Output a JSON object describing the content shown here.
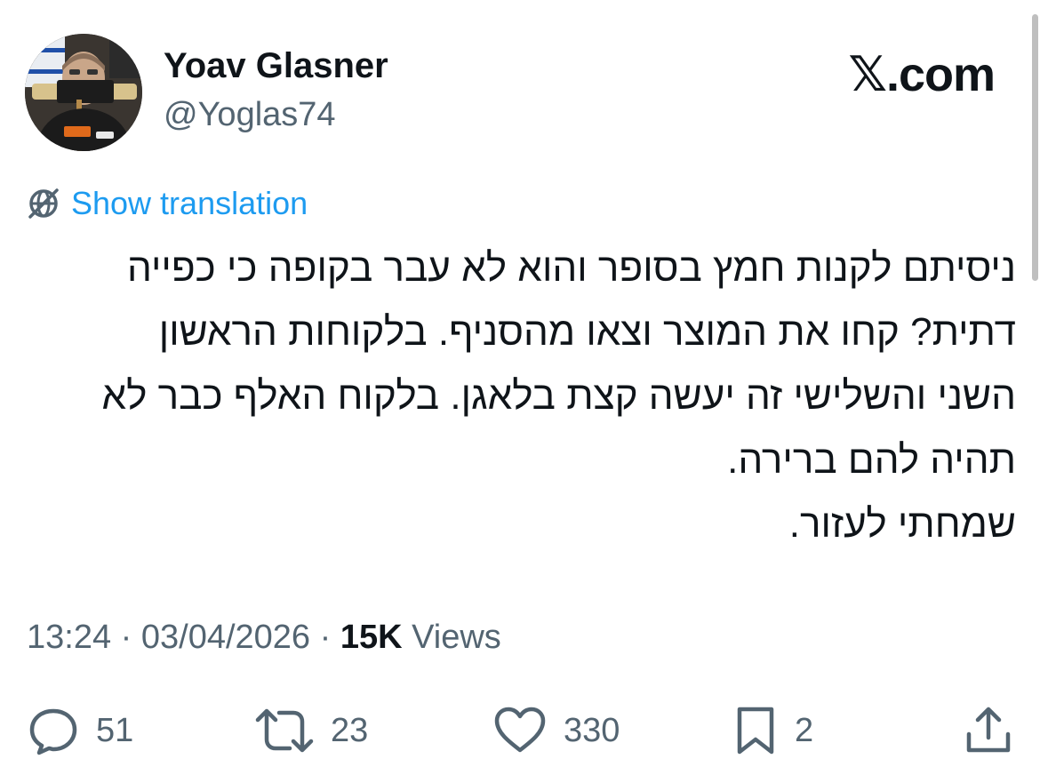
{
  "author": {
    "display_name": "Yoav Glasner",
    "handle": "@Yoglas74",
    "avatar_icon": "profile-photo"
  },
  "brand": "𝕏.com",
  "translation": {
    "icon": "translate-globe-icon",
    "label": "Show translation"
  },
  "tweet": {
    "lines": [
      "ניסיתם לקנות חמץ בסופר והוא לא עבר בקופה כי כפייה",
      "דתית? קחו את המוצר וצאו מהסניף. בלקוחות הראשון",
      "השני והשלישי זה יעשה קצת בלאגן. בלקוח האלף כבר לא",
      "תהיה להם ברירה.",
      "שמחתי לעזור."
    ]
  },
  "meta": {
    "time": "13:24",
    "separator": " · ",
    "date": "03/04/2026",
    "views_count": "15K",
    "views_label": " Views"
  },
  "actions": {
    "replies": "51",
    "reposts": "23",
    "likes": "330",
    "bookmarks": "2"
  },
  "colors": {
    "link": "#1d9bf0",
    "secondary_text": "#536471",
    "primary_text": "#0f1419"
  }
}
